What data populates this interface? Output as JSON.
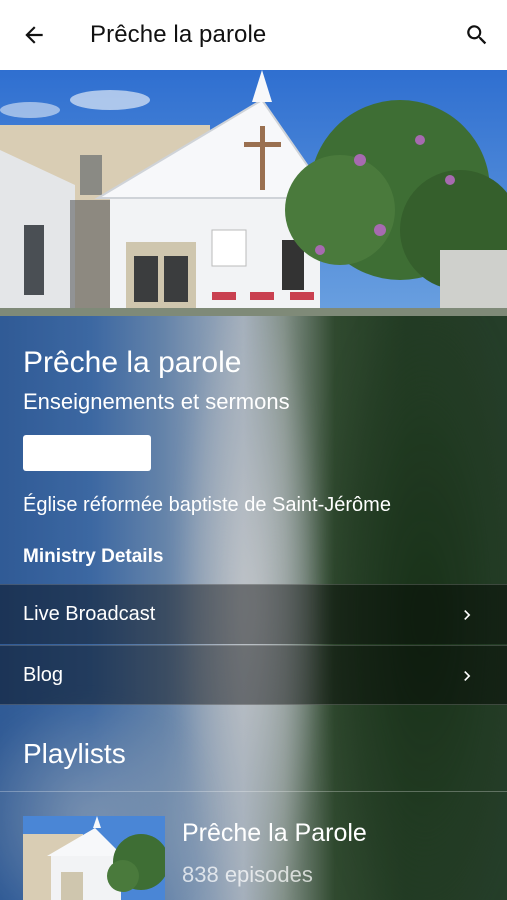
{
  "appbar": {
    "title": "Prêche la parole",
    "back_icon": "arrow-left-icon",
    "search_icon": "search-icon"
  },
  "ministry": {
    "title": "Prêche la parole",
    "subtitle": "Enseignements et sermons",
    "follow_label": "",
    "church": "Église réformée baptiste de Saint-Jérôme",
    "details_heading": "Ministry Details"
  },
  "details": [
    {
      "label": "Live Broadcast",
      "icon": "chevron-right-icon"
    },
    {
      "label": "Blog",
      "icon": "chevron-right-icon"
    }
  ],
  "playlists": {
    "heading": "Playlists",
    "items": [
      {
        "title": "Prêche la Parole",
        "count": "838 episodes"
      }
    ]
  },
  "colors": {
    "appbar_bg": "#ffffff",
    "text_primary": "#ffffff",
    "row_overlay": "rgba(0,0,0,0.42)"
  }
}
